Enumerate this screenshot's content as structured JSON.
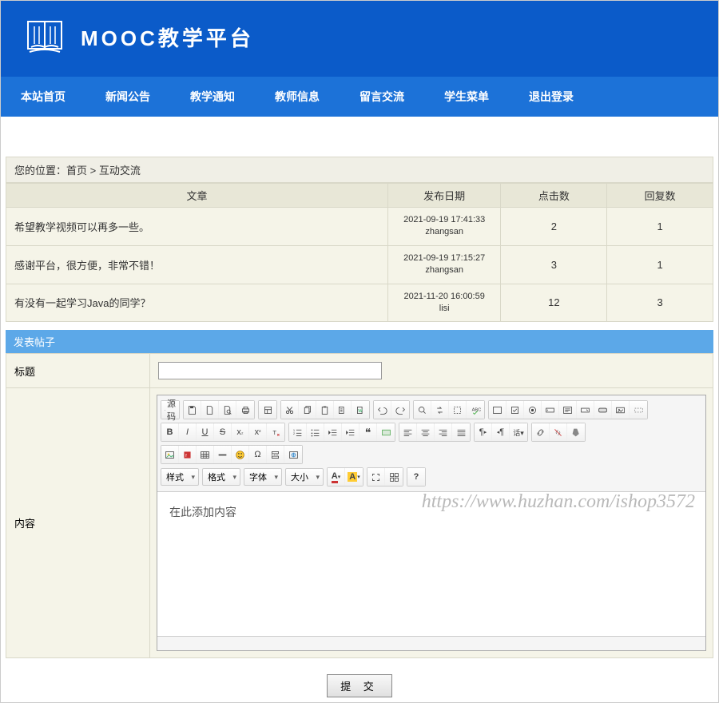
{
  "site_title": "MOOC教学平台",
  "nav": [
    "本站首页",
    "新闻公告",
    "教学通知",
    "教师信息",
    "留言交流",
    "学生菜单",
    "退出登录"
  ],
  "breadcrumb": "您的位置：首页 > 互动交流",
  "table": {
    "headers": [
      "文章",
      "发布日期",
      "点击数",
      "回复数"
    ],
    "rows": [
      {
        "title": "希望教学视频可以再多一些。",
        "date": "2021-09-19 17:41:33",
        "user": "zhangsan",
        "clicks": "2",
        "replies": "1"
      },
      {
        "title": "感谢平台，很方便，非常不错！",
        "date": "2021-09-19 17:15:27",
        "user": "zhangsan",
        "clicks": "3",
        "replies": "1"
      },
      {
        "title": "有没有一起学习Java的同学？",
        "date": "2021-11-20 16:00:59",
        "user": "lisi",
        "clicks": "12",
        "replies": "3"
      }
    ]
  },
  "section_title": "发表帖子",
  "form": {
    "title_label": "标题",
    "content_label": "内容",
    "title_value": "",
    "editor_placeholder": "在此添加内容",
    "submit_label": "提 交"
  },
  "editor": {
    "source": "源码",
    "selects": {
      "style": "样式",
      "format": "格式",
      "font": "字体",
      "size": "大小"
    }
  },
  "watermark": "https://www.huzhan.com/ishop3572"
}
